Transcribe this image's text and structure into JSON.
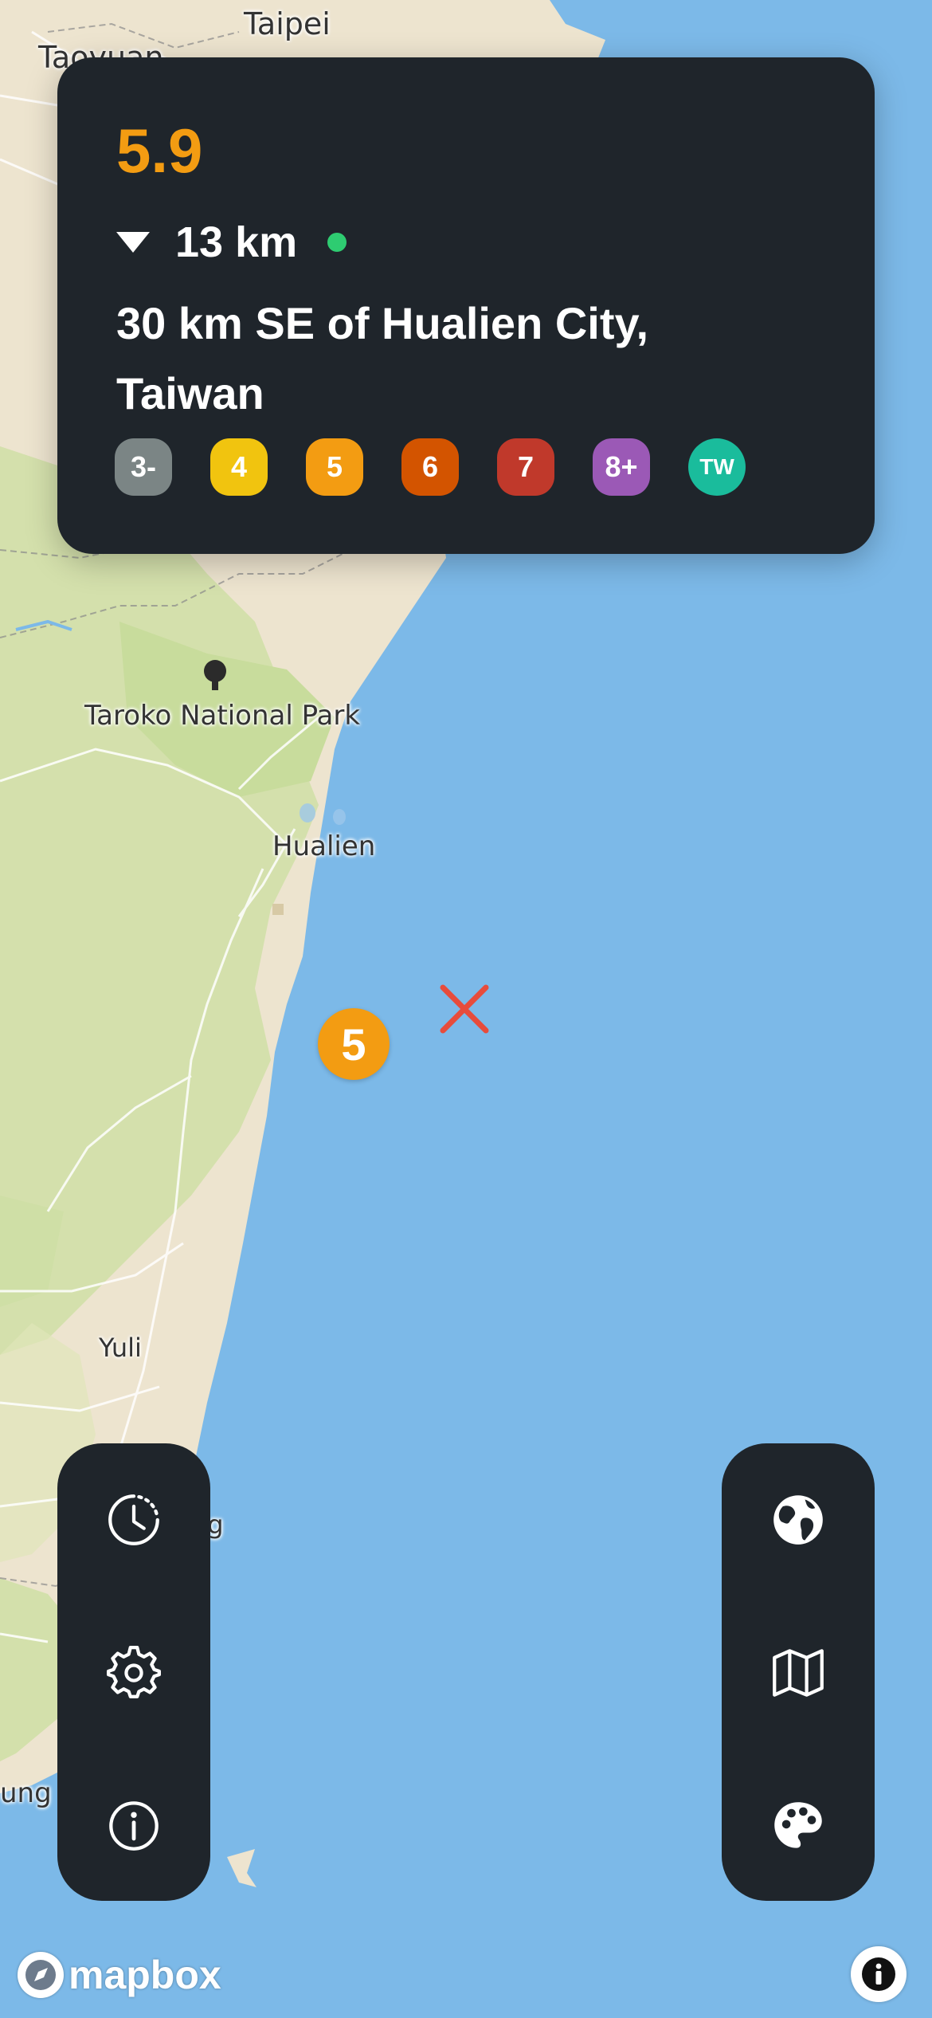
{
  "map": {
    "places": {
      "taipei": "Taipei",
      "taoyuan": "Taoyuan",
      "taroko": "Taroko National Park",
      "hualien": "Hualien",
      "yuli": "Yuli",
      "partial_ng": "ng",
      "partial_ung": "ung"
    },
    "colors": {
      "sea": "#7cb9e8",
      "land": "#ede4cf",
      "forest": "#cfdfa6"
    }
  },
  "quake": {
    "magnitude": "5.9",
    "depth": "13 km",
    "location": "30 km SE of Hualien City, Taiwan",
    "magnitude_color": "#f39c12",
    "live_color": "#2ecc71",
    "marker_label": "5"
  },
  "legend": [
    {
      "label": "3-",
      "color": "#7b8585"
    },
    {
      "label": "4",
      "color": "#f1c40f"
    },
    {
      "label": "5",
      "color": "#f39c12"
    },
    {
      "label": "6",
      "color": "#d35400"
    },
    {
      "label": "7",
      "color": "#c0392b"
    },
    {
      "label": "8+",
      "color": "#9b59b6"
    },
    {
      "label": "TW",
      "color": "#1abc9c"
    }
  ],
  "toolbar_left": [
    "history-icon",
    "settings-icon",
    "info-icon"
  ],
  "toolbar_right": [
    "globe-icon",
    "map-icon",
    "palette-icon"
  ],
  "mapbox": {
    "brand": "mapbox"
  }
}
